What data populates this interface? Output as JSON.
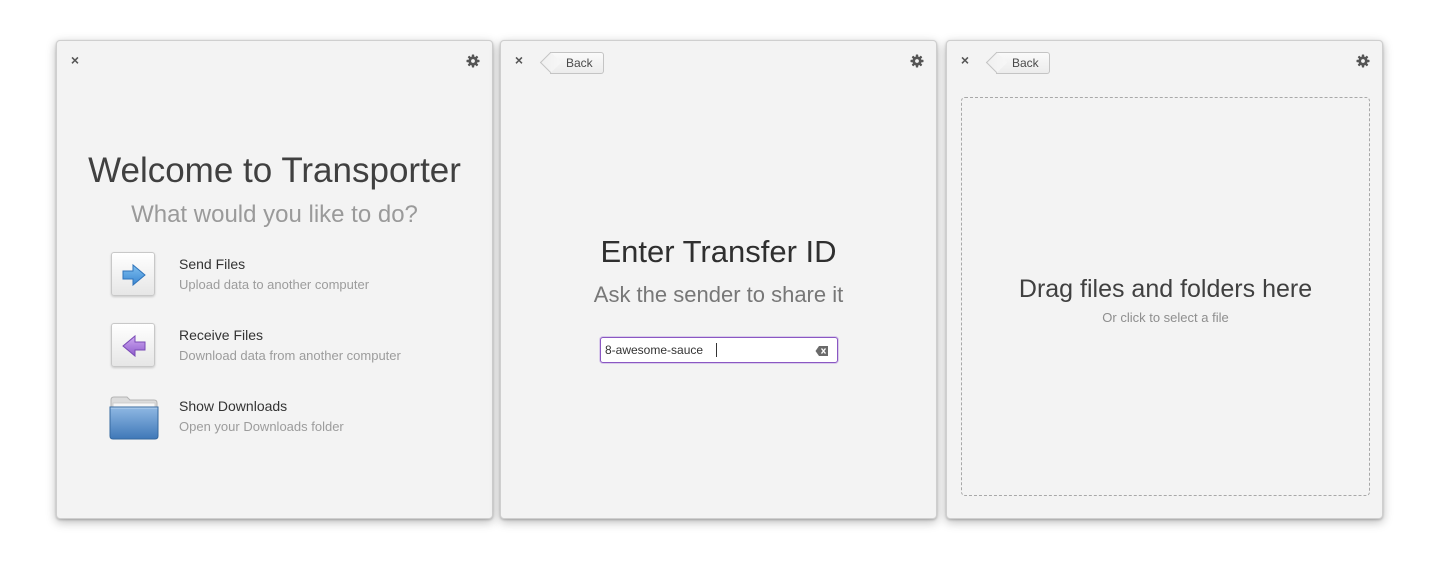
{
  "welcome": {
    "close_glyph": "×",
    "title": "Welcome to Transporter",
    "subtitle": "What would you like to do?",
    "actions": [
      {
        "title": "Send Files",
        "description": "Upload data to another computer",
        "icon": "arrow-right-icon",
        "color": "#4a90d9"
      },
      {
        "title": "Receive Files",
        "description": "Download data from another computer",
        "icon": "arrow-left-icon",
        "color": "#9d6fd0"
      },
      {
        "title": "Show Downloads",
        "description": "Open your Downloads folder",
        "icon": "folder-icon",
        "color": "#4f86c0"
      }
    ]
  },
  "receive": {
    "close_glyph": "×",
    "back_label": "Back",
    "title": "Enter Transfer ID",
    "subtitle": "Ask the sender to share it",
    "transfer_id_value": "8-awesome-sauce",
    "input_border_color": "#8a57c2"
  },
  "send": {
    "close_glyph": "×",
    "back_label": "Back",
    "drop_title": "Drag files and folders here",
    "drop_subtitle": "Or click to select a file"
  }
}
